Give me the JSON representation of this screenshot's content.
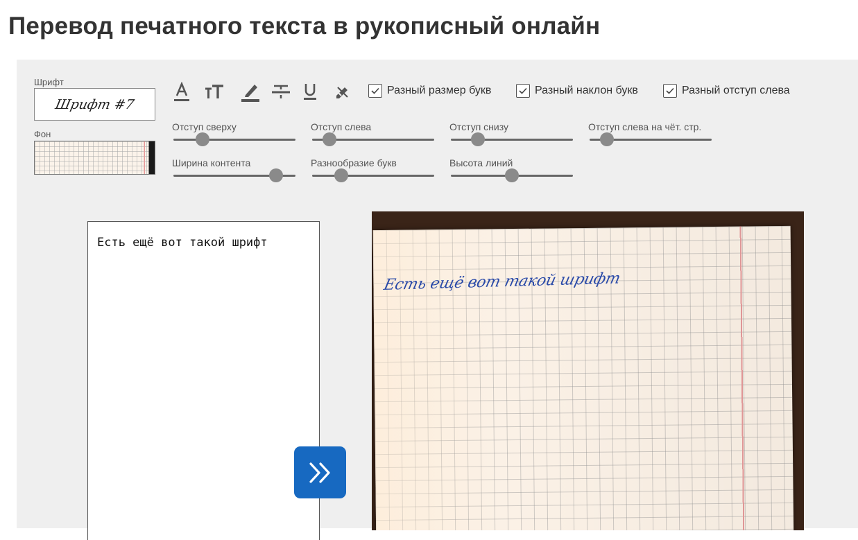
{
  "page": {
    "title": "Перевод печатного текста в рукописный онлайн"
  },
  "settings": {
    "font_label": "Шрифт",
    "font_value": "Шрифт #7",
    "background_label": "Фон",
    "tools": [
      {
        "icon": "text-color-icon"
      },
      {
        "icon": "text-size-icon"
      },
      {
        "icon": "highlighter-icon"
      },
      {
        "icon": "strikethrough-icon"
      },
      {
        "icon": "underline-icon"
      },
      {
        "icon": "eraser-pen-icon"
      }
    ],
    "checkboxes": [
      {
        "label": "Разный размер букв",
        "checked": true
      },
      {
        "label": "Разный наклон букв",
        "checked": true
      },
      {
        "label": "Разный отступ слева",
        "checked": true
      }
    ],
    "sliders": [
      {
        "label": "Отступ сверху",
        "value": 0.24
      },
      {
        "label": "Отступ слева",
        "value": 0.14
      },
      {
        "label": "Отступ снизу",
        "value": 0.22
      },
      {
        "label": "Отступ слева на чёт. стр.",
        "value": 0.14
      },
      {
        "label": "Ширина контента",
        "value": 0.84
      },
      {
        "label": "Разнообразие букв",
        "value": 0.24
      },
      {
        "label": "Высота линий",
        "value": 0.5
      }
    ]
  },
  "editor": {
    "text": "Есть ещё вот такой шрифт"
  },
  "preview": {
    "handwritten_text": "Есть ещё вот такой шрифт"
  },
  "colors": {
    "accent": "#1769c1",
    "ink": "#2a4aa8",
    "panel_bg": "#efefef",
    "margin_line": "#e59a9a"
  }
}
